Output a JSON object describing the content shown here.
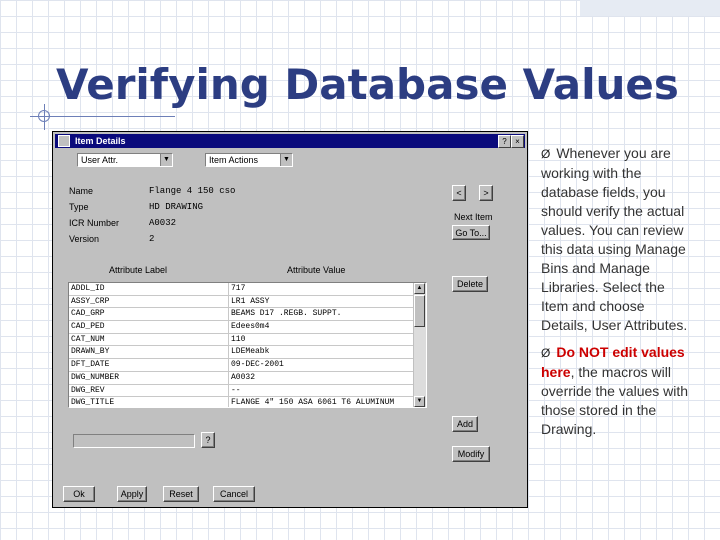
{
  "slide": {
    "title": "Verifying Database Values"
  },
  "dialog": {
    "title": "Item Details",
    "titlebar_buttons": [
      "?",
      "×"
    ],
    "combos": {
      "user_attr": "User Attr.",
      "item_actions": "Item Actions"
    },
    "fields": [
      {
        "label": "Name",
        "value": "Flange 4 150 cso"
      },
      {
        "label": "Type",
        "value": "HD DRAWING"
      },
      {
        "label": "ICR Number",
        "value": "A0032"
      },
      {
        "label": "Version",
        "value": "2"
      }
    ],
    "nav": {
      "prev": "<",
      "next": ">",
      "next_item_label": "Next Item",
      "goto": "Go To..."
    },
    "table": {
      "headers": [
        "Attribute Label",
        "Attribute Value"
      ],
      "rows": [
        [
          "ADDL_ID",
          "717"
        ],
        [
          "ASSY_CRP",
          "LR1 ASSY"
        ],
        [
          "CAD_GRP",
          "BEAMS D17 .REGB. SUPPT."
        ],
        [
          "CAD_PED",
          "Edees0m4"
        ],
        [
          "CAT_NUM",
          "110"
        ],
        [
          "DRAWN_BY",
          "LDEMeabk"
        ],
        [
          "DFT_DATE",
          "09-DEC-2001"
        ],
        [
          "DWG_NUMBER",
          "A0032"
        ],
        [
          "DWG_REV",
          "--"
        ],
        [
          "DWG_TITLE",
          "FLANGE 4\" 150 ASA 6061 T6 ALUMINUM"
        ]
      ]
    },
    "buttons": {
      "delete": "Delete",
      "add": "Add",
      "modify": "Modify",
      "help_small": "?",
      "ok": "Ok",
      "apply": "Apply",
      "reset": "Reset",
      "cancel": "Cancel"
    }
  },
  "bullets": [
    {
      "mark": "Ø",
      "text": "Whenever you are working with the database fields, you should verify the actual values. You can review this data using Manage Bins and Manage Libraries. Select the Item and choose Details, User Attributes."
    },
    {
      "mark": "Ø",
      "emphasis": "Do NOT edit values here",
      "text": ", the macros will override the values with those stored in the Drawing."
    }
  ],
  "colors": {
    "title": "#2c3d82",
    "emphasis": "#cc0000",
    "titlebar": "#0a0a7c"
  }
}
